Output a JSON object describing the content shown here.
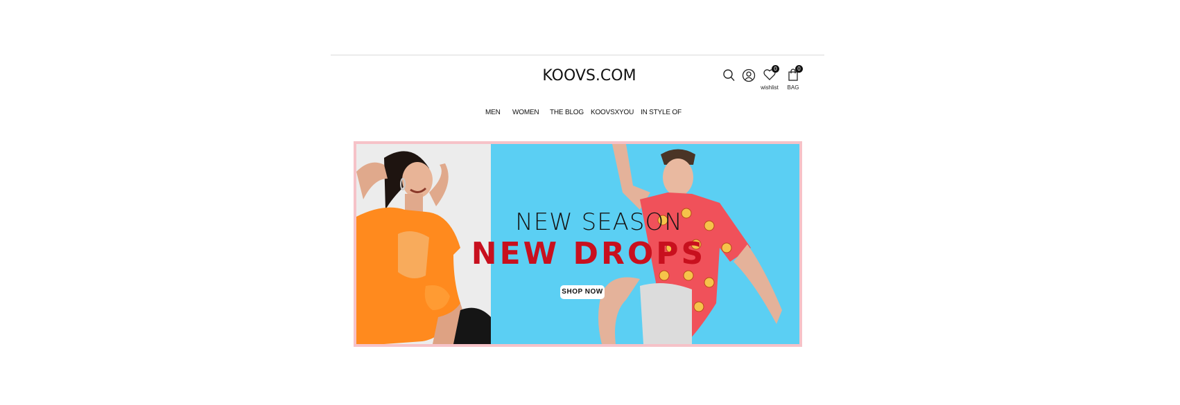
{
  "header": {
    "logo": "KOOVS.COM",
    "wishlist": {
      "label": "wishlist",
      "count": "0"
    },
    "bag": {
      "label": "BAG",
      "count": "0"
    }
  },
  "nav": {
    "items": [
      {
        "label": "MEN"
      },
      {
        "label": "WOMEN"
      },
      {
        "label": "THE BLOG"
      },
      {
        "label": "KOOVSXYOU"
      },
      {
        "label": "IN STYLE OF"
      }
    ]
  },
  "banner": {
    "headline": "NEW SEASON",
    "subheadline": "NEW DROPS",
    "cta": "SHOP NOW",
    "colors": {
      "border": "#f6c2c8",
      "left_bg": "#ececec",
      "right_bg": "#5bcff3",
      "accent_red": "#c8101e",
      "shirt_orange": "#ff8a1e",
      "shirt_red": "#f0515a"
    }
  },
  "icons": [
    "search-icon",
    "user-icon",
    "heart-icon",
    "bag-icon"
  ]
}
